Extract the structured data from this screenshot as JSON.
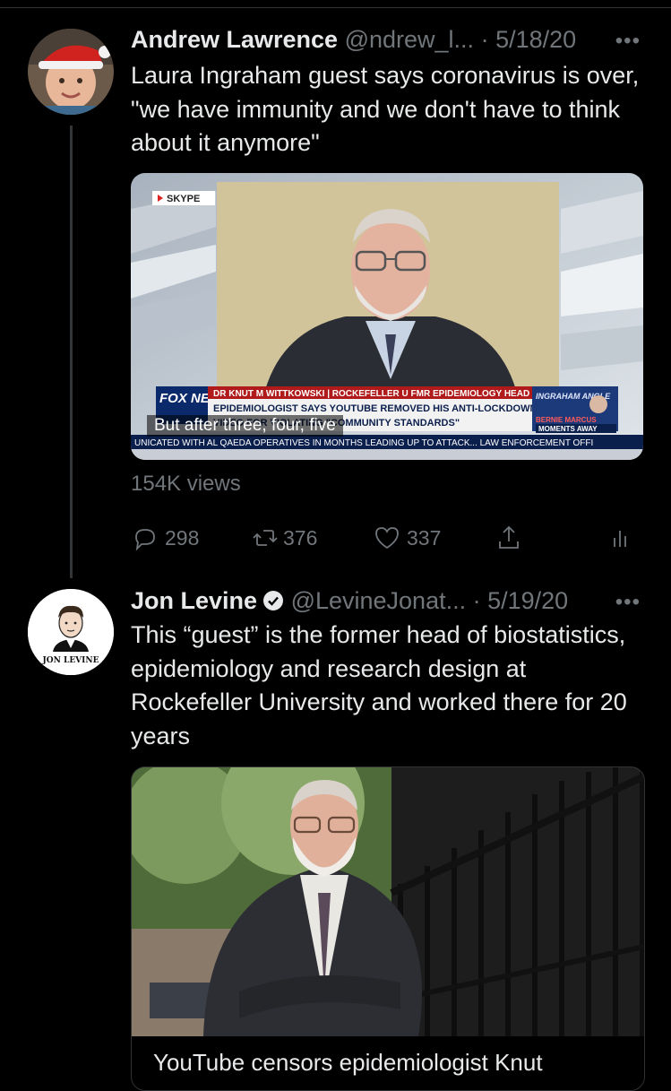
{
  "tweets": [
    {
      "name": "Andrew Lawrence",
      "handle": "@ndrew_l...",
      "date": "· 5/18/20",
      "more": "•••",
      "text": "Laura Ingraham guest says coronavirus is over, \"we have immunity and we don't have to think about it anymore\"",
      "video": {
        "skype_label": "SKYPE",
        "banner_top": "DR KNUT M WITTKOWSKI | ROCKEFELLER U FMR EPIDEMIOLOGY HEAD",
        "headline_line1": "EPIDEMIOLOGIST SAYS YOUTUBE REMOVED HIS ANTI-LOCKDOWN",
        "headline_line2": "VIDEO FOR VIOLATING \"COMMUNITY STANDARDS\"",
        "ticker": "UNICATED WITH AL QAEDA OPERATIVES IN MONTHS LEADING UP TO ATTACK... LAW ENFORCEMENT OFFI",
        "network_logo": "FOX NEWS",
        "promo_title": "INGRAHAM ANGLE",
        "promo_name": "BERNIE MARCUS",
        "promo_sub": "MOMENTS AWAY",
        "caption": "But after three, four, five"
      },
      "views": "154K views",
      "replies": "298",
      "retweets": "376",
      "likes": "337"
    },
    {
      "name": "Jon Levine",
      "handle": "@LevineJonat...",
      "date": "· 5/19/20",
      "more": "•••",
      "avatar_caption": "JON LEVINE",
      "text": "This “guest” is the former head of biostatistics, epidemiology and research design at Rockefeller University and worked there for 20 years",
      "link_title": "YouTube censors epidemiologist Knut"
    }
  ],
  "colors": {
    "background": "#000000",
    "text": "#e7e9ea",
    "secondary": "#71767b",
    "verified": "#1d9bf0"
  },
  "icons": [
    "reply-icon",
    "retweet-icon",
    "like-icon",
    "share-icon",
    "analytics-icon",
    "verified-icon",
    "more-icon"
  ]
}
